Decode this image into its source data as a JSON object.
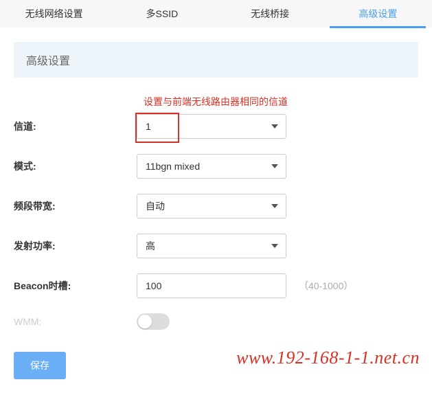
{
  "tabs": [
    {
      "label": "无线网络设置",
      "active": false
    },
    {
      "label": "多SSID",
      "active": false
    },
    {
      "label": "无线桥接",
      "active": false
    },
    {
      "label": "高级设置",
      "active": true
    }
  ],
  "section_title": "高级设置",
  "hint_text": "设置与前端无线路由器相同的信道",
  "form": {
    "channel": {
      "label": "信道:",
      "value": "1"
    },
    "mode": {
      "label": "模式:",
      "value": "11bgn mixed"
    },
    "bandwidth": {
      "label": "频段带宽:",
      "value": "自动"
    },
    "tx_power": {
      "label": "发射功率:",
      "value": "高"
    },
    "beacon": {
      "label": "Beacon时槽:",
      "value": "100",
      "range": "（40-1000）"
    },
    "wmm": {
      "label": "WMM:",
      "enabled": false
    }
  },
  "save_button": "保存",
  "watermark": "www.192-168-1-1.net.cn"
}
